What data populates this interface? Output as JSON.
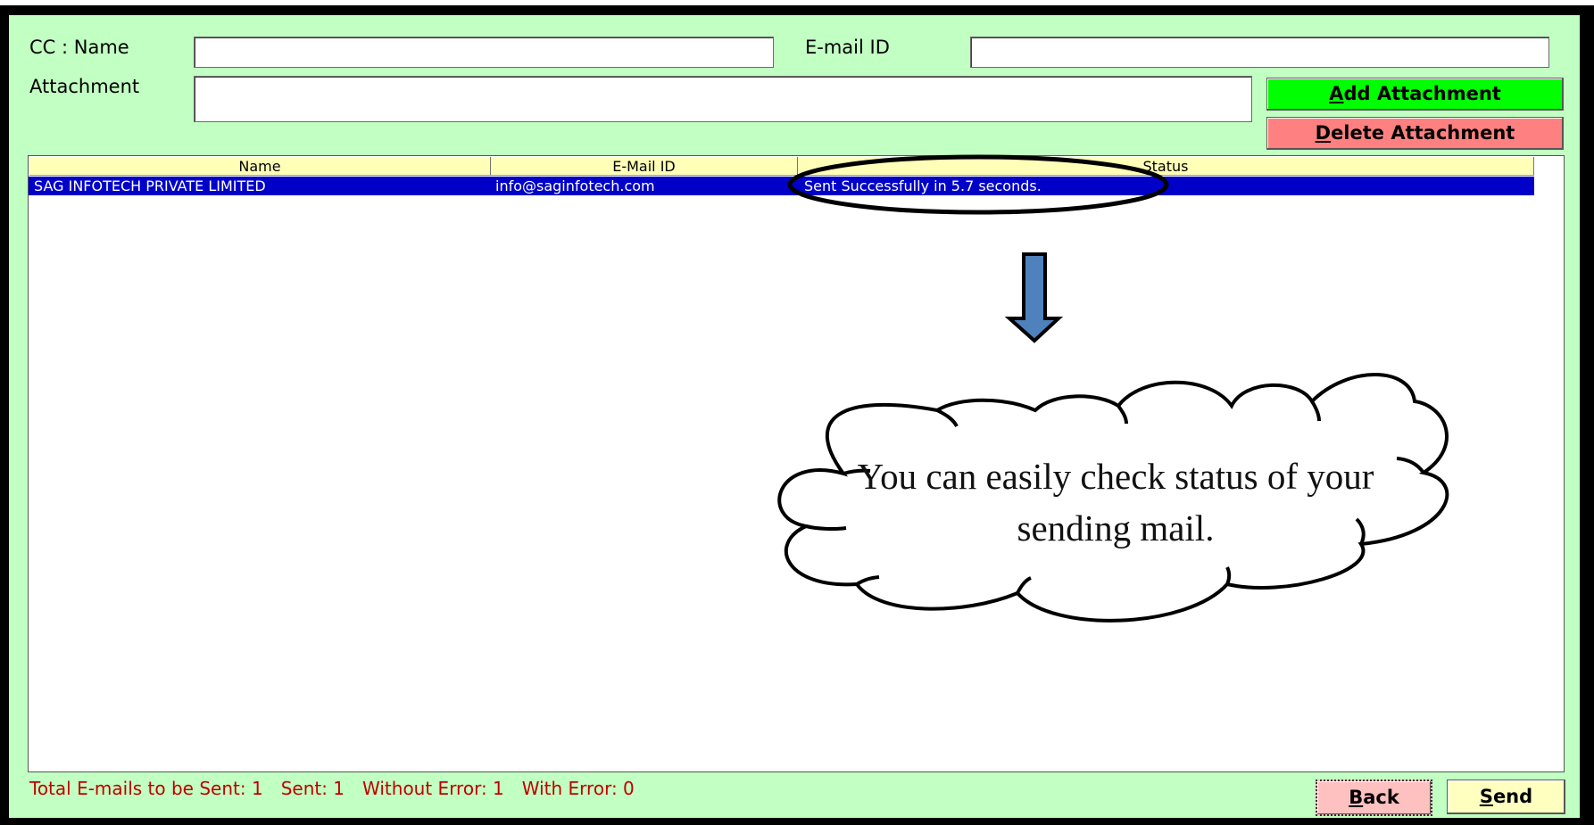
{
  "form": {
    "cc_name_label": "CC : Name",
    "cc_name_value": "",
    "email_label": "E-mail ID",
    "email_value": "",
    "attachment_label": "Attachment",
    "attachment_value": ""
  },
  "buttons": {
    "add_attachment": {
      "key": "A",
      "rest": "dd Attachment",
      "color": "#00ff00"
    },
    "delete_attachment": {
      "key": "D",
      "rest": "elete Attachment",
      "color": "#ff8080"
    },
    "back": {
      "key": "B",
      "rest": "ack",
      "color": "#ffc0c0"
    },
    "send": {
      "key": "S",
      "rest": "end",
      "color": "#ffffc0"
    }
  },
  "table": {
    "columns": [
      "Name",
      "E-Mail ID",
      "Status"
    ],
    "rows": [
      {
        "name": "SAG INFOTECH PRIVATE LIMITED",
        "email": "info@saginfotech.com",
        "status": "Sent Successfully in 5.7 seconds."
      }
    ],
    "selected_row_color": "#0000c8",
    "header_color": "#ffffb8"
  },
  "summary": {
    "total": "Total E-mails to be Sent: 1",
    "sent": "Sent: 1",
    "without_error": "Without Error: 1",
    "with_error": "With Error: 0"
  },
  "annotation": {
    "callout_text": "You can easily check status of your sending mail.",
    "arrow_color": "#4f81bd"
  },
  "colors": {
    "panel_bg": "#c2ffc2",
    "summary_text": "#c00000"
  }
}
